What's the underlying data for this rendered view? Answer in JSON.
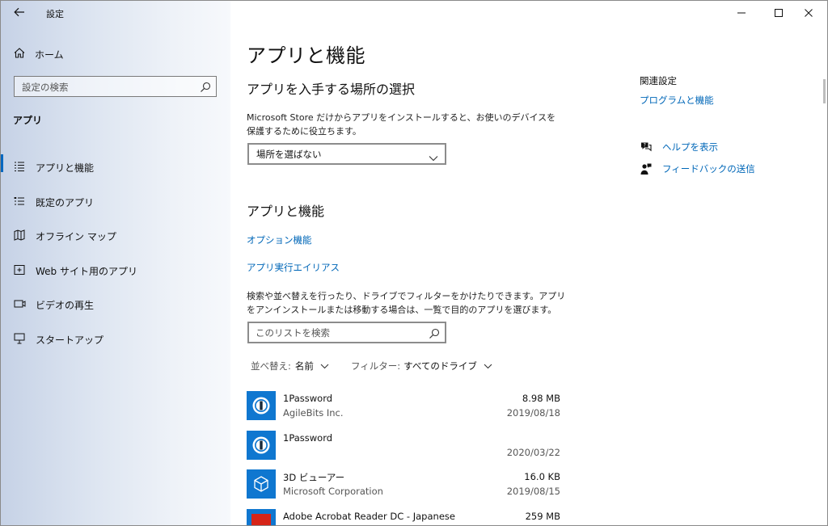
{
  "window": {
    "title": "設定",
    "buttons": [
      "minimize",
      "maximize",
      "close"
    ]
  },
  "sidebar": {
    "home_label": "ホーム",
    "search_placeholder": "設定の検索",
    "section_title": "アプリ",
    "items": [
      {
        "label": "アプリと機能",
        "icon": "list-icon",
        "selected": true
      },
      {
        "label": "既定のアプリ",
        "icon": "default-apps-icon",
        "selected": false
      },
      {
        "label": "オフライン マップ",
        "icon": "map-icon",
        "selected": false
      },
      {
        "label": "Web サイト用のアプリ",
        "icon": "website-app-icon",
        "selected": false
      },
      {
        "label": "ビデオの再生",
        "icon": "video-icon",
        "selected": false
      },
      {
        "label": "スタートアップ",
        "icon": "startup-icon",
        "selected": false
      }
    ]
  },
  "main": {
    "page_title": "アプリと機能",
    "install_section": {
      "heading": "アプリを入手する場所の選択",
      "description": "Microsoft Store だけからアプリをインストールすると、お使いのデバイスを保護するために役立ちます。",
      "dropdown_value": "場所を選ばない"
    },
    "apps_section": {
      "heading": "アプリと機能",
      "optional_features_link": "オプション機能",
      "alias_link": "アプリ実行エイリアス",
      "description": "検索や並べ替えを行ったり、ドライブでフィルターをかけたりできます。アプリをアンインストールまたは移動する場合は、一覧で目的のアプリを選びます。",
      "search_placeholder": "このリストを検索",
      "sort_label": "並べ替え:",
      "sort_value": "名前",
      "filter_label": "フィルター:",
      "filter_value": "すべてのドライブ"
    },
    "apps": [
      {
        "name": "1Password",
        "publisher": "AgileBits Inc.",
        "size": "8.98 MB",
        "date": "2019/08/18",
        "icon": "1password-icon"
      },
      {
        "name": "1Password",
        "publisher": "",
        "size": "",
        "date": "2020/03/22",
        "icon": "1password-icon"
      },
      {
        "name": "3D ビューアー",
        "publisher": "Microsoft Corporation",
        "size": "16.0 KB",
        "date": "2019/08/15",
        "icon": "3d-viewer-icon"
      },
      {
        "name": "Adobe Acrobat Reader DC - Japanese",
        "publisher": "",
        "size": "259 MB",
        "date": "",
        "icon": "acrobat-icon"
      }
    ]
  },
  "related": {
    "heading": "関連設定",
    "programs_link": "プログラムと機能",
    "help_link": "ヘルプを表示",
    "feedback_link": "フィードバックの送信"
  },
  "colors": {
    "accent": "#0067b8",
    "tile": "#0f77d0",
    "acrobat": "#d62418"
  }
}
